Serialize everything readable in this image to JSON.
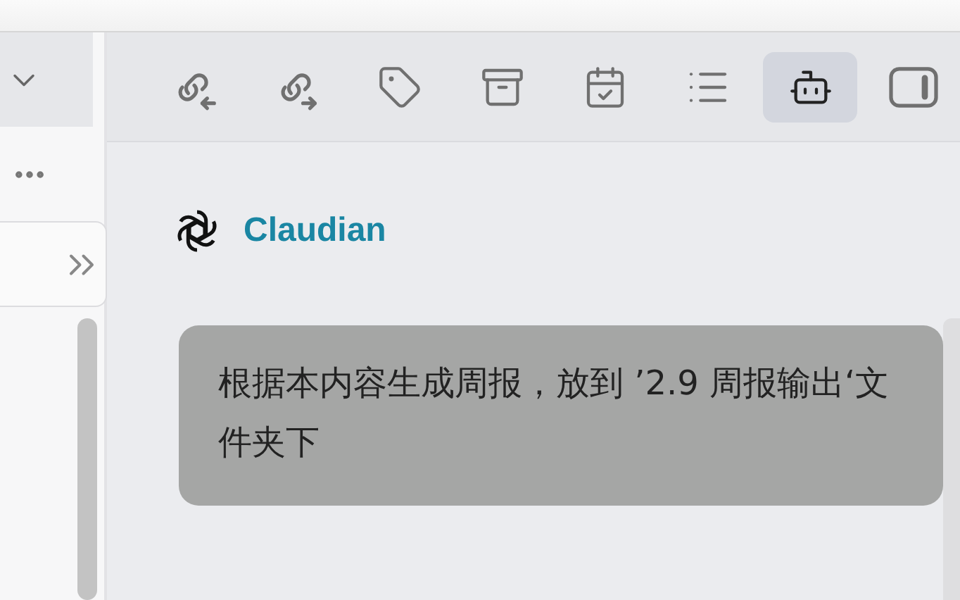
{
  "toolbar": {
    "buttons": [
      {
        "kind": "backlinks",
        "selected": false
      },
      {
        "kind": "outlinks",
        "selected": false
      },
      {
        "kind": "tags",
        "selected": false
      },
      {
        "kind": "archive",
        "selected": false
      },
      {
        "kind": "calendar",
        "selected": false
      },
      {
        "kind": "outline",
        "selected": false
      },
      {
        "kind": "assistant",
        "selected": true
      },
      {
        "kind": "sidebar",
        "selected": false
      }
    ]
  },
  "chat": {
    "title": "Claudian",
    "messages": [
      {
        "text": "根据本内容生成周报，放到 ’2.9 周报输出‘文件夹下"
      }
    ]
  }
}
